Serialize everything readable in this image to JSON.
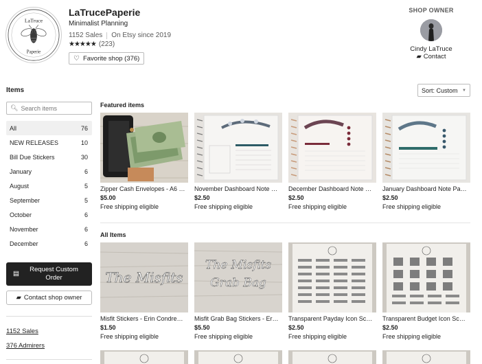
{
  "shop": {
    "name": "LaTrucePaperie",
    "tagline": "Minimalist Planning",
    "sales": "1152 Sales",
    "since": "On Etsy since 2019",
    "stars": "★★★★★",
    "reviews": "(223)",
    "favorite_label": "Favorite shop (376)",
    "logo_text_top": "LaTruce",
    "logo_text_bottom": "Paperie"
  },
  "owner": {
    "title": "SHOP OWNER",
    "name": "Cindy LaTruce",
    "contact": "Contact"
  },
  "sidebar": {
    "heading": "Items",
    "search_placeholder": "Search items",
    "categories": [
      {
        "label": "All",
        "count": "76"
      },
      {
        "label": "NEW RELEASES",
        "count": "10"
      },
      {
        "label": "Bill Due Stickers",
        "count": "30"
      },
      {
        "label": "January",
        "count": "6"
      },
      {
        "label": "August",
        "count": "5"
      },
      {
        "label": "September",
        "count": "5"
      },
      {
        "label": "October",
        "count": "6"
      },
      {
        "label": "November",
        "count": "6"
      },
      {
        "label": "December",
        "count": "6"
      }
    ],
    "request_order": "Request Custom Order",
    "contact_owner": "Contact shop owner",
    "sales_link": "1152 Sales",
    "admirers_link": "376 Admirers"
  },
  "sort": {
    "label": "Sort: Custom"
  },
  "featured": {
    "title": "Featured items",
    "items": [
      {
        "title": "Zipper Cash Envelopes - A6 …",
        "price": "$5.00",
        "shipping": "Free shipping eligible"
      },
      {
        "title": "November Dashboard Note …",
        "price": "$2.50",
        "shipping": "Free shipping eligible"
      },
      {
        "title": "December Dashboard Note …",
        "price": "$2.50",
        "shipping": "Free shipping eligible"
      },
      {
        "title": "January Dashboard Note Pa…",
        "price": "$2.50",
        "shipping": "Free shipping eligible"
      }
    ]
  },
  "all_items": {
    "title": "All Items",
    "items": [
      {
        "title": "Misfit Stickers - Erin Condre…",
        "price": "$1.50",
        "shipping": "Free shipping eligible",
        "image_text": "The Misfits"
      },
      {
        "title": "Misfit Grab Bag Stickers - Er…",
        "price": "$5.50",
        "shipping": "Free shipping eligible",
        "image_text": "The Misfits Grab Bag"
      },
      {
        "title": "Transparent Payday Icon Sc…",
        "price": "$2.50",
        "shipping": "Free shipping eligible"
      },
      {
        "title": "Transparent Budget Icon Sc…",
        "price": "$2.50",
        "shipping": "Free shipping eligible"
      }
    ]
  },
  "icons": {
    "favorite": "heart-icon",
    "contact": "message-icon",
    "search": "search-icon",
    "request": "document-icon",
    "sort": "caret-down-icon"
  }
}
